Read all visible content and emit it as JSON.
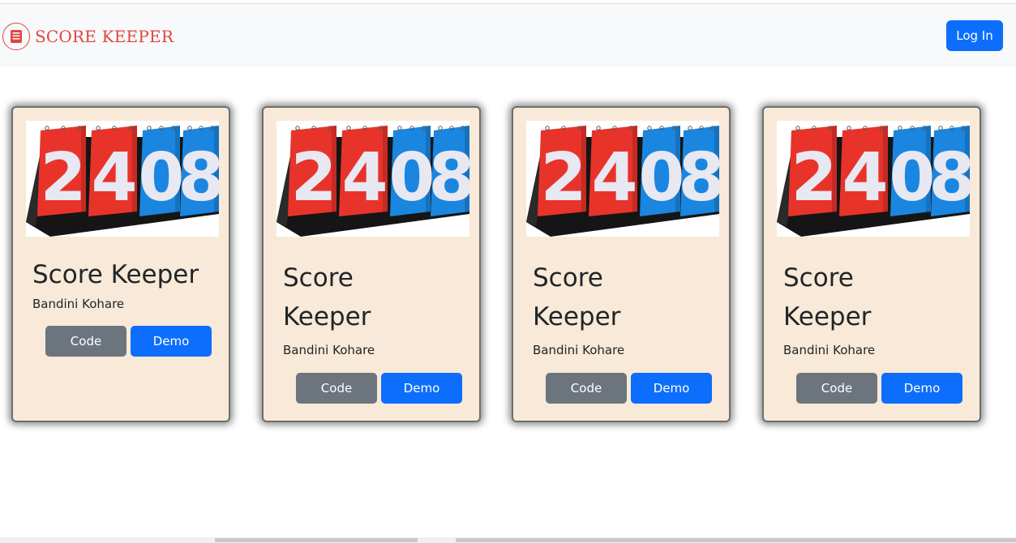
{
  "navbar": {
    "brand": "SCORE KEEPER",
    "login_label": "Log In",
    "brand_color": "#e0453f",
    "login_color": "#0d6efd"
  },
  "cards": [
    {
      "title": "Score Keeper",
      "author": "Bandini Kohare",
      "code_label": "Code",
      "demo_label": "Demo",
      "scoreboard": [
        "2",
        "4",
        "0",
        "8"
      ]
    },
    {
      "title": "Score Keeper",
      "author": "Bandini Kohare",
      "code_label": "Code",
      "demo_label": "Demo",
      "scoreboard": [
        "2",
        "4",
        "0",
        "8"
      ]
    },
    {
      "title": "Score Keeper",
      "author": "Bandini Kohare",
      "code_label": "Code",
      "demo_label": "Demo",
      "scoreboard": [
        "2",
        "4",
        "0",
        "8"
      ]
    },
    {
      "title": "Score Keeper",
      "author": "Bandini Kohare",
      "code_label": "Code",
      "demo_label": "Demo",
      "scoreboard": [
        "2",
        "4",
        "0",
        "8"
      ]
    }
  ],
  "colors": {
    "card_bg": "#f8e9d8",
    "code_button": "#6c757d",
    "demo_button": "#0d6efd",
    "score_red": "#e8332b",
    "score_blue": "#1a86e0"
  },
  "icons": {
    "brand_logo": "scoreboard-icon"
  }
}
